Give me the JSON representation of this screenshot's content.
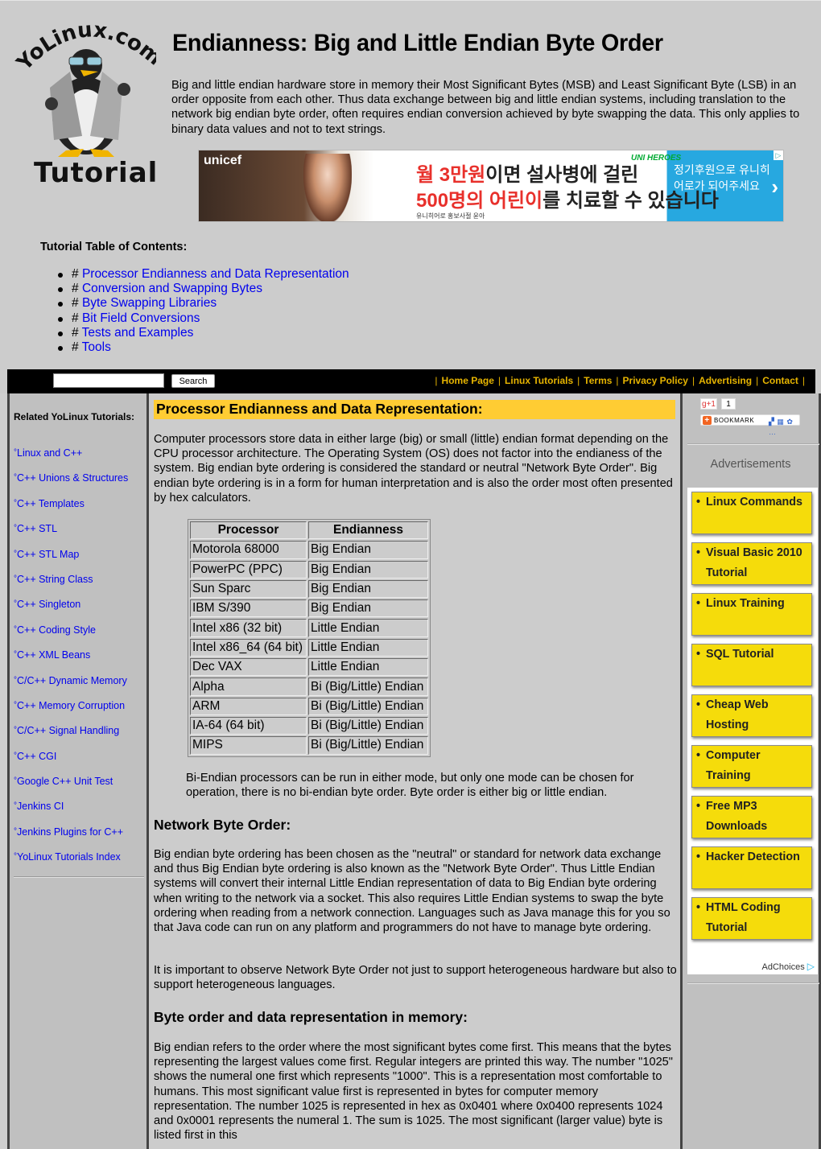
{
  "header": {
    "logo_top_text": "YoLinux.com",
    "logo_bottom_text": "Tutorial",
    "title": "Endianness: Big and Little Endian Byte Order",
    "intro": "Big and little endian hardware store in memory their Most Significant Bytes (MSB) and Least Significant Byte (LSB) in an order opposite from each other. Thus data exchange between big and little endian systems, including translation to the network big endian byte order, often requires endian conversion achieved by byte swapping the data. This only applies to binary data values and not to text strings."
  },
  "banner_ad": {
    "brand": "unicef",
    "line1_red": "월 3만원",
    "line1_rest": "이면 설사병에 걸린",
    "line2_red": "500명의 어린이",
    "line2_rest": "를 치료할 수 있습니다",
    "caption": "유니히어로 홍보사절 윤아",
    "badge": "UNI HEROES",
    "cta": "정기후원으로 유니히어로가 되어주세요"
  },
  "toc": {
    "title": "Tutorial Table of Contents:",
    "hash": "#",
    "items": [
      "Processor Endianness and Data Representation",
      "Conversion and Swapping Bytes",
      "Byte Swapping Libraries",
      "Bit Field Conversions",
      "Tests and Examples",
      "Tools"
    ]
  },
  "navbar": {
    "search_value": "",
    "search_button": "Search",
    "links": [
      "Home Page",
      "Linux Tutorials",
      "Terms",
      "Privacy Policy",
      "Advertising",
      "Contact"
    ],
    "separator": "|"
  },
  "sidebar_left": {
    "heading": "Related YoLinux Tutorials:",
    "bullet": "°",
    "items": [
      "Linux and C++",
      "C++ Unions & Structures",
      "C++ Templates",
      "C++ STL",
      "C++ STL Map",
      "C++ String Class",
      "C++ Singleton",
      "C++ Coding Style",
      "C++ XML Beans",
      "C/C++ Dynamic Memory",
      "C++ Memory Corruption",
      "C/C++ Signal Handling",
      "C++ CGI",
      "Google C++ Unit Test",
      "Jenkins CI",
      "Jenkins Plugins for C++",
      "YoLinux Tutorials Index"
    ]
  },
  "main": {
    "section1_title": "Processor Endianness and Data Representation:",
    "section1_p1": "Computer processors store data in either large (big) or small (little) endian format depending on the CPU processor architecture. The Operating System (OS) does not factor into the endianess of the system. Big endian byte ordering is considered the standard or neutral \"Network Byte Order\". Big endian byte ordering is in a form for human interpretation and is also the order most often presented by hex calculators.",
    "table": {
      "headers": [
        "Processor",
        "Endianness"
      ],
      "rows": [
        [
          "Motorola 68000",
          "Big Endian"
        ],
        [
          "PowerPC (PPC)",
          "Big Endian"
        ],
        [
          "Sun Sparc",
          "Big Endian"
        ],
        [
          "IBM S/390",
          "Big Endian"
        ],
        [
          "Intel x86 (32 bit)",
          "Little Endian"
        ],
        [
          "Intel x86_64 (64 bit)",
          "Little Endian"
        ],
        [
          "Dec VAX",
          "Little Endian"
        ],
        [
          "Alpha",
          "Bi (Big/Little) Endian"
        ],
        [
          "ARM",
          "Bi (Big/Little) Endian"
        ],
        [
          "IA-64 (64 bit)",
          "Bi (Big/Little) Endian"
        ],
        [
          "MIPS",
          "Bi (Big/Little) Endian"
        ]
      ]
    },
    "bi_endian_note": "Bi-Endian processors can be run in either mode, but only one mode can be chosen for operation, there is no bi-endian byte order. Byte order is either big or little endian.",
    "section2_title": "Network Byte Order:",
    "section2_p1": "Big endian byte ordering has been chosen as the \"neutral\" or standard for network data exchange and thus Big Endian byte ordering is also known as the \"Network Byte Order\". Thus Little Endian systems will convert their internal Little Endian representation of data to Big Endian byte ordering when writing to the network via a socket. This also requires Little Endian systems to swap the byte ordering when reading from a network connection. Languages such as Java manage this for you so that Java code can run on any platform and programmers do not have to manage byte ordering.",
    "section2_p2": "It is important to observe Network Byte Order not just to support heterogeneous hardware but also to support heterogeneous languages.",
    "section3_title": "Byte order and data representation in memory:",
    "section3_p1": "Big endian refers to the order where the most significant bytes come first. This means that the bytes representing the largest values come first. Regular integers are printed this way. The number \"1025\" shows the numeral one first which represents \"1000\". This is a representation most comfortable to humans. This most significant value first is represented in bytes for computer memory representation. The number 1025 is represented in hex as 0x0401 where 0x0400 represents 1024 and 0x0001 represents the numeral 1. The sum is 1025. The most significant (larger value) byte is listed first in this"
  },
  "sidebar_right": {
    "gplus_label": "g+1",
    "gplus_count": "1",
    "bookmark_label": "BOOKMARK",
    "ads_label": "Advertisements",
    "ad_items": [
      "Linux Commands",
      "Visual Basic 2010 Tutorial",
      "Linux Training",
      "SQL Tutorial",
      "Cheap Web Hosting",
      "Computer Training",
      "Free MP3 Downloads",
      "Hacker Detection",
      "HTML Coding Tutorial"
    ],
    "adchoices_label": "AdChoices"
  },
  "colors": {
    "page_bg": "#cccccc",
    "link": "#0000ee",
    "section_highlight": "#ffcc33",
    "navbar_bg": "#000000",
    "navbar_link": "#e6b400",
    "ad_item_bg": "#f5dc0b"
  }
}
